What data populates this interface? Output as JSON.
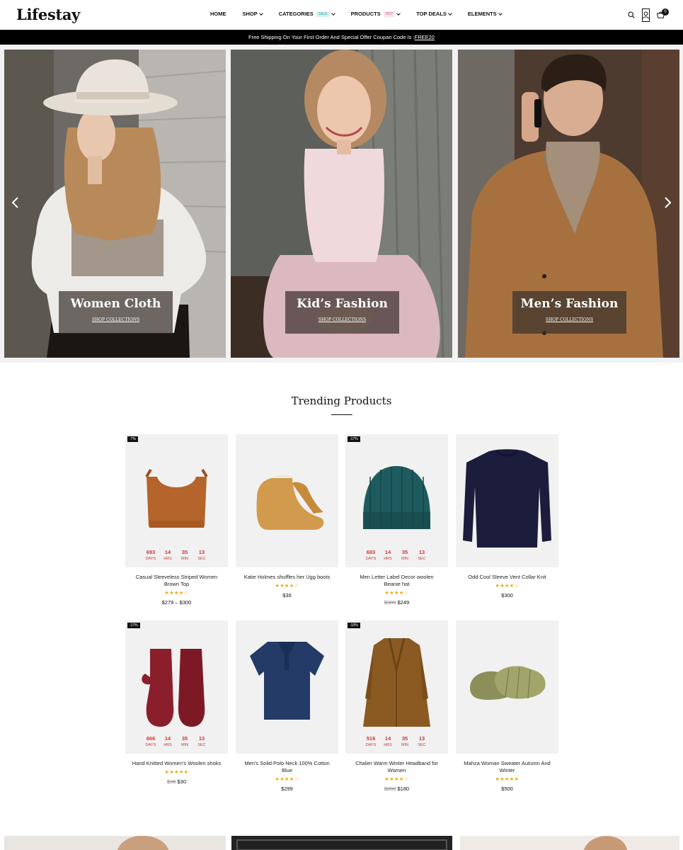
{
  "header": {
    "logo": "Lifestay",
    "nav": [
      {
        "label": "HOME",
        "chevron": false,
        "badge": ""
      },
      {
        "label": "SHOP",
        "chevron": true,
        "badge": ""
      },
      {
        "label": "CATEGORIES",
        "chevron": true,
        "badge": "SALE"
      },
      {
        "label": "PRODUCTS",
        "chevron": true,
        "badge": "HOT"
      },
      {
        "label": "TOP DEALS",
        "chevron": true,
        "badge": ""
      },
      {
        "label": "ELEMENTS",
        "chevron": true,
        "badge": ""
      }
    ],
    "cart_count": "0",
    "icons": [
      "search-icon",
      "user-icon",
      "cart-icon"
    ]
  },
  "announcement": {
    "text": "Free Shipping On Your First Order And Special Offer Coupan Code Is :",
    "code": "FREE20"
  },
  "hero": {
    "slides": [
      {
        "title": "Women Cloth",
        "link": "SHOP COLLECTIONS"
      },
      {
        "title": "Kid’s Fashion",
        "link": "SHOP COLLECTIONS"
      },
      {
        "title": "Men’s Fashion",
        "link": "SHOP COLLECTIONS"
      }
    ]
  },
  "trending": {
    "title": "Trending Products",
    "countdown_labels": [
      "DAYS",
      "HRS",
      "MIN",
      "SEC"
    ],
    "products": [
      {
        "name": "Casual Sleeveless Striped Women Brown Top",
        "discount": "-7%",
        "countdown": [
          "693",
          "14",
          "35",
          "13"
        ],
        "rating": 4,
        "old_price": "",
        "price": "$279 – $300"
      },
      {
        "name": "Katie Holmes shuffles her Ugg boots",
        "discount": "",
        "countdown": [],
        "rating": 4,
        "old_price": "",
        "price": "$36"
      },
      {
        "name": "Men Letter Label Decor woolen Beanie hat",
        "discount": "-17%",
        "countdown": [
          "693",
          "14",
          "35",
          "13"
        ],
        "rating": 4,
        "old_price": "$300",
        "price": "$249"
      },
      {
        "name": "Odd Cool Sleeve Vent Collar Knit",
        "discount": "",
        "countdown": [],
        "rating": 4,
        "old_price": "",
        "price": "$300"
      },
      {
        "name": "Hand Knitted Women’s Woolen shoks",
        "discount": "-17%",
        "countdown": [
          "666",
          "14",
          "35",
          "13"
        ],
        "rating": 5,
        "old_price": "$36",
        "price": "$30"
      },
      {
        "name": "Men’s Solid Polo Neck 100% Cotton Blue",
        "discount": "",
        "countdown": [],
        "rating": 4,
        "old_price": "",
        "price": "$299"
      },
      {
        "name": "Chalier Warm Winter Headband for Women",
        "discount": "-10%",
        "countdown": [
          "516",
          "14",
          "35",
          "13"
        ],
        "rating": 4,
        "old_price": "$200",
        "price": "$180"
      },
      {
        "name": "Mahza Woman Sweater Autumn And Winter",
        "discount": "",
        "countdown": [],
        "rating": 5,
        "old_price": "",
        "price": "$500"
      }
    ]
  },
  "colors": {
    "countdown": "#c9383a",
    "star": "#f0a500",
    "announcement_bg": "#000000"
  }
}
